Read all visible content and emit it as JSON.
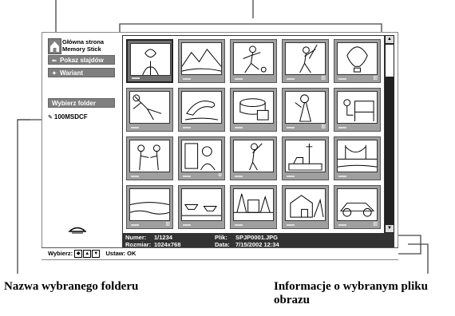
{
  "sidebar": {
    "home_label": "Główna strona Memory Stick",
    "slideshow_label": "Pokaz slajdów",
    "options_label": "Wariant",
    "choose_folder_label": "Wybierz folder",
    "folder_name": "100MSDCF"
  },
  "thumbnails": [
    {
      "subject": "flowers",
      "mark": ""
    },
    {
      "subject": "landscape",
      "mark": ""
    },
    {
      "subject": "soccer-player",
      "mark": ""
    },
    {
      "subject": "baseball-player",
      "mark": "▥"
    },
    {
      "subject": "hot-air-balloon",
      "mark": "▥"
    },
    {
      "subject": "diver",
      "mark": ""
    },
    {
      "subject": "dolphin",
      "mark": ""
    },
    {
      "subject": "cake",
      "mark": ""
    },
    {
      "subject": "singer",
      "mark": "▥"
    },
    {
      "subject": "pianist",
      "mark": ""
    },
    {
      "subject": "people-talking",
      "mark": ""
    },
    {
      "subject": "couple",
      "mark": "⊕"
    },
    {
      "subject": "golfer",
      "mark": ""
    },
    {
      "subject": "tower",
      "mark": ""
    },
    {
      "subject": "bridge",
      "mark": ""
    },
    {
      "subject": "sunset",
      "mark": "▥"
    },
    {
      "subject": "boats",
      "mark": ""
    },
    {
      "subject": "garden",
      "mark": ""
    },
    {
      "subject": "house",
      "mark": ""
    },
    {
      "subject": "race-car",
      "mark": "▥"
    }
  ],
  "info": {
    "number_label": "Numer:",
    "number_value": "1/1234",
    "size_label": "Rozmiar:",
    "size_value": "1024x768",
    "file_label": "Plik:",
    "file_value": "SPJP0001.JPG",
    "date_label": "Data:",
    "date_value": "7/15/2002 12:34"
  },
  "statusbar": {
    "select_label": "Wybierz:",
    "set_label": "Ustaw: OK"
  },
  "captions": {
    "folder_name": "Nazwa wybranego folderu",
    "file_info": "Informacje o wybranym pliku obrazu"
  }
}
